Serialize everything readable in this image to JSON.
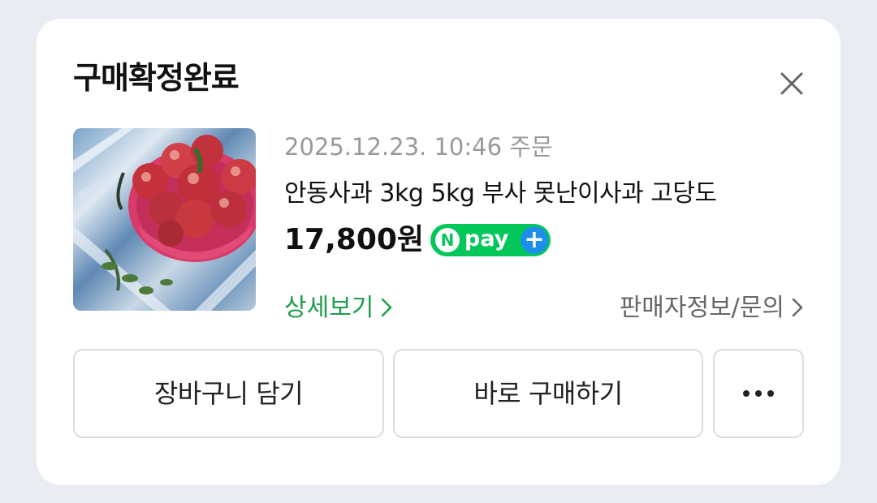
{
  "dialog": {
    "title": "구매확정완료",
    "close_icon": "close-icon"
  },
  "product": {
    "image_icon": "apple-basket-thumbnail",
    "order_date": "2025.12.23. 10:46 주문",
    "name": "안동사과 3kg 5kg 부사 못난이사과 고당도",
    "price": "17,800원",
    "npay": {
      "n": "N",
      "text": "pay",
      "plus": "+"
    },
    "detail_link": "상세보기",
    "seller_link": "판매자정보/문의"
  },
  "buttons": {
    "cart": "장바구니 담기",
    "buy_now": "바로 구매하기",
    "more_icon": "more-horizontal-icon"
  },
  "colors": {
    "accent_green": "#1e9e4a",
    "npay_green": "#03c75a",
    "npay_blue": "#1e8fe8",
    "background": "#e9ecf0"
  }
}
